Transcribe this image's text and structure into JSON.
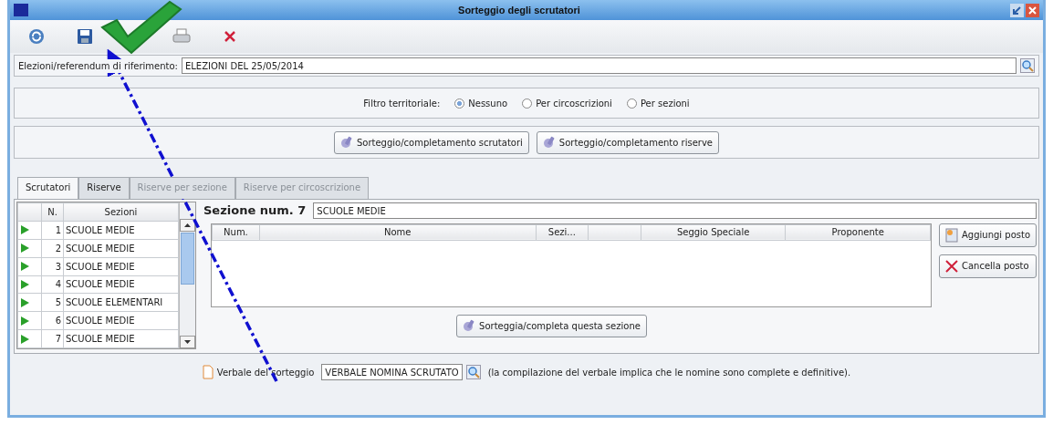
{
  "window": {
    "title": "Sorteggio degli scrutatori"
  },
  "election": {
    "label": "Elezioni/referendum di riferimento:",
    "value": "ELEZIONI  DEL 25/05/2014"
  },
  "filter": {
    "label": "Filtro territoriale:",
    "options": [
      {
        "label": "Nessuno",
        "selected": true
      },
      {
        "label": "Per circoscrizioni",
        "selected": false
      },
      {
        "label": "Per sezioni",
        "selected": false
      }
    ]
  },
  "draw_buttons": [
    "Sorteggio/completamento scrutatori",
    "Sorteggio/completamento riserve"
  ],
  "tabs": [
    {
      "label": "Scrutatori",
      "selected": true,
      "disabled": false
    },
    {
      "label": "Riserve",
      "selected": false,
      "disabled": false
    },
    {
      "label": "Riserve per sezione",
      "selected": false,
      "disabled": true
    },
    {
      "label": "Riserve per circoscrizione",
      "selected": false,
      "disabled": true
    }
  ],
  "sections": {
    "columns": [
      "N.",
      "Sezioni"
    ],
    "rows": [
      {
        "number": "1",
        "name": "SCUOLE MEDIE"
      },
      {
        "number": "2",
        "name": "SCUOLE MEDIE"
      },
      {
        "number": "3",
        "name": "SCUOLE MEDIE"
      },
      {
        "number": "4",
        "name": "SCUOLE MEDIE"
      },
      {
        "number": "5",
        "name": "SCUOLE ELEMENTARI"
      },
      {
        "number": "6",
        "name": "SCUOLE MEDIE"
      },
      {
        "number": "7",
        "name": "SCUOLE MEDIE"
      }
    ]
  },
  "section_detail": {
    "label": "Sezione num. 7",
    "value": "SCUOLE MEDIE",
    "columns": [
      "Num.",
      "Nome",
      "Sezi...",
      "",
      "Seggio Speciale",
      "Proponente"
    ],
    "side_buttons": [
      {
        "label": "Aggiungi posto",
        "kind": "add"
      },
      {
        "label": "Cancella posto",
        "kind": "delete"
      }
    ],
    "draw_button": "Sorteggia/completa questa sezione"
  },
  "footer": {
    "label": "Verbale del sorteggio",
    "value": "VERBALE NOMINA SCRUTATO",
    "note": "(la compilazione del verbale implica che le nomine sono complete e definitive)."
  }
}
